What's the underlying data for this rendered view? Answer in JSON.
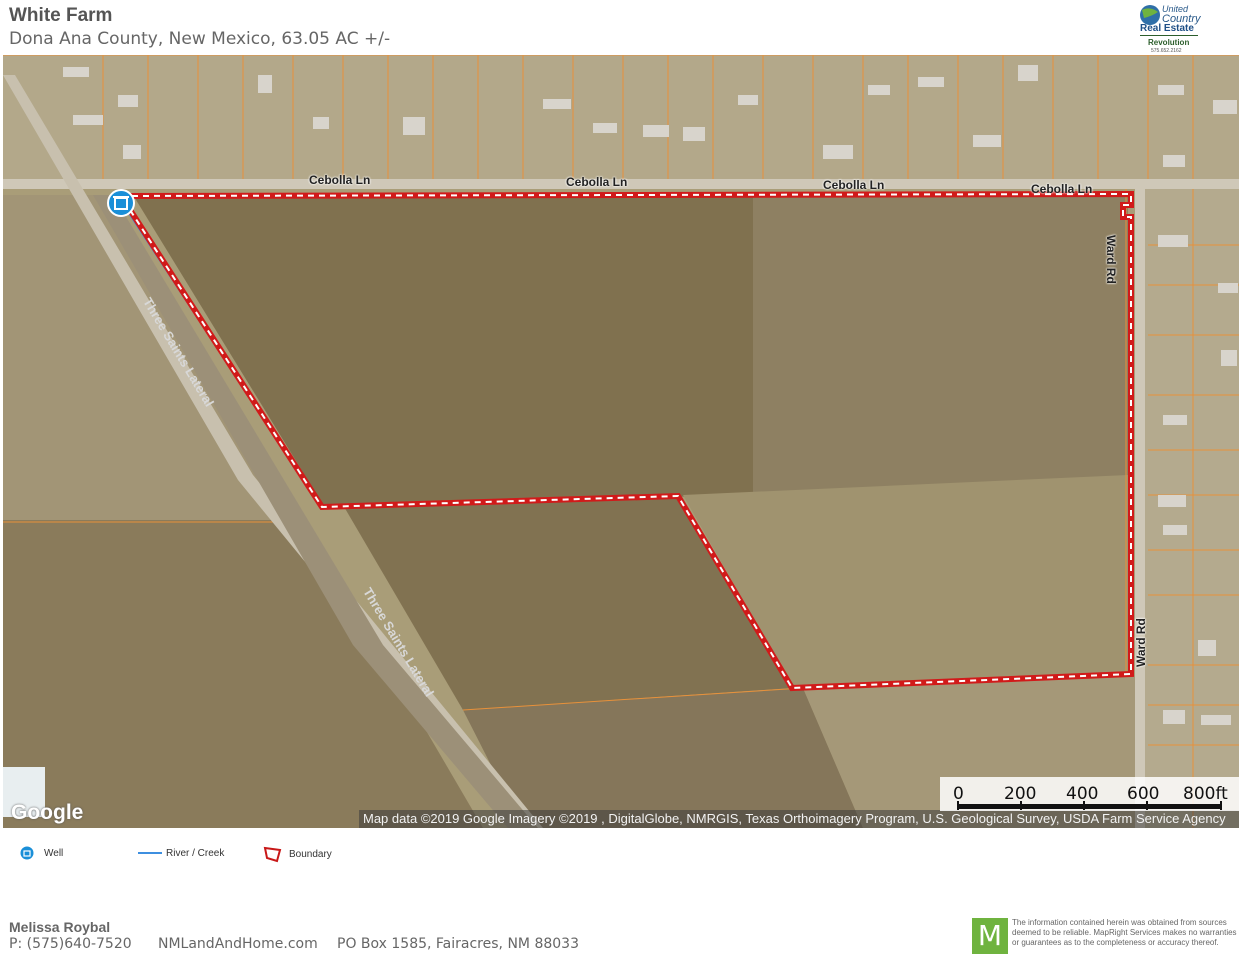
{
  "header": {
    "title": "White Farm",
    "subtitle": "Dona Ana County, New Mexico, 63.05 AC +/-"
  },
  "logo": {
    "line1": "United",
    "line2": "Country",
    "line3": "Real Estate",
    "line4": "Revolution",
    "phone": "575.652.2162"
  },
  "map": {
    "roads": [
      "Cebolla Ln",
      "Cebolla Ln",
      "Cebolla Ln",
      "Cebolla Ln",
      "Ward Rd",
      "Ward Rd",
      "Three Saints Lateral",
      "Three Saints Lateral"
    ],
    "google_logo": "Google",
    "attribution": "Map data ©2019 Google  Imagery ©2019 , DigitalGlobe, NMRGIS, Texas Orthoimagery Program, U.S. Geological Survey, USDA Farm Service Agency",
    "scale_labels": [
      "0",
      "200",
      "400",
      "600",
      "800ft"
    ],
    "colors": {
      "boundary": "#d11a1a",
      "creek": "#3d8fe0",
      "parcel_lines": "#e8913a",
      "well": "#1a8fd8"
    }
  },
  "legend": {
    "items": [
      {
        "label": "Well",
        "icon": "well-icon"
      },
      {
        "label": "River / Creek",
        "icon": "creek-line-icon"
      },
      {
        "label": "Boundary",
        "icon": "boundary-icon"
      }
    ]
  },
  "footer": {
    "agent_name": "Melissa Roybal",
    "phone": "P: (575)640-7520",
    "website": "NMLandAndHome.com",
    "address": "PO Box 1585, Fairacres, NM 88033",
    "mapright_logo": "M",
    "disclaimer": "The information contained herein was obtained from sources deemed to be reliable. MapRight Services makes no warranties or guarantees as to the completeness or accuracy thereof."
  }
}
